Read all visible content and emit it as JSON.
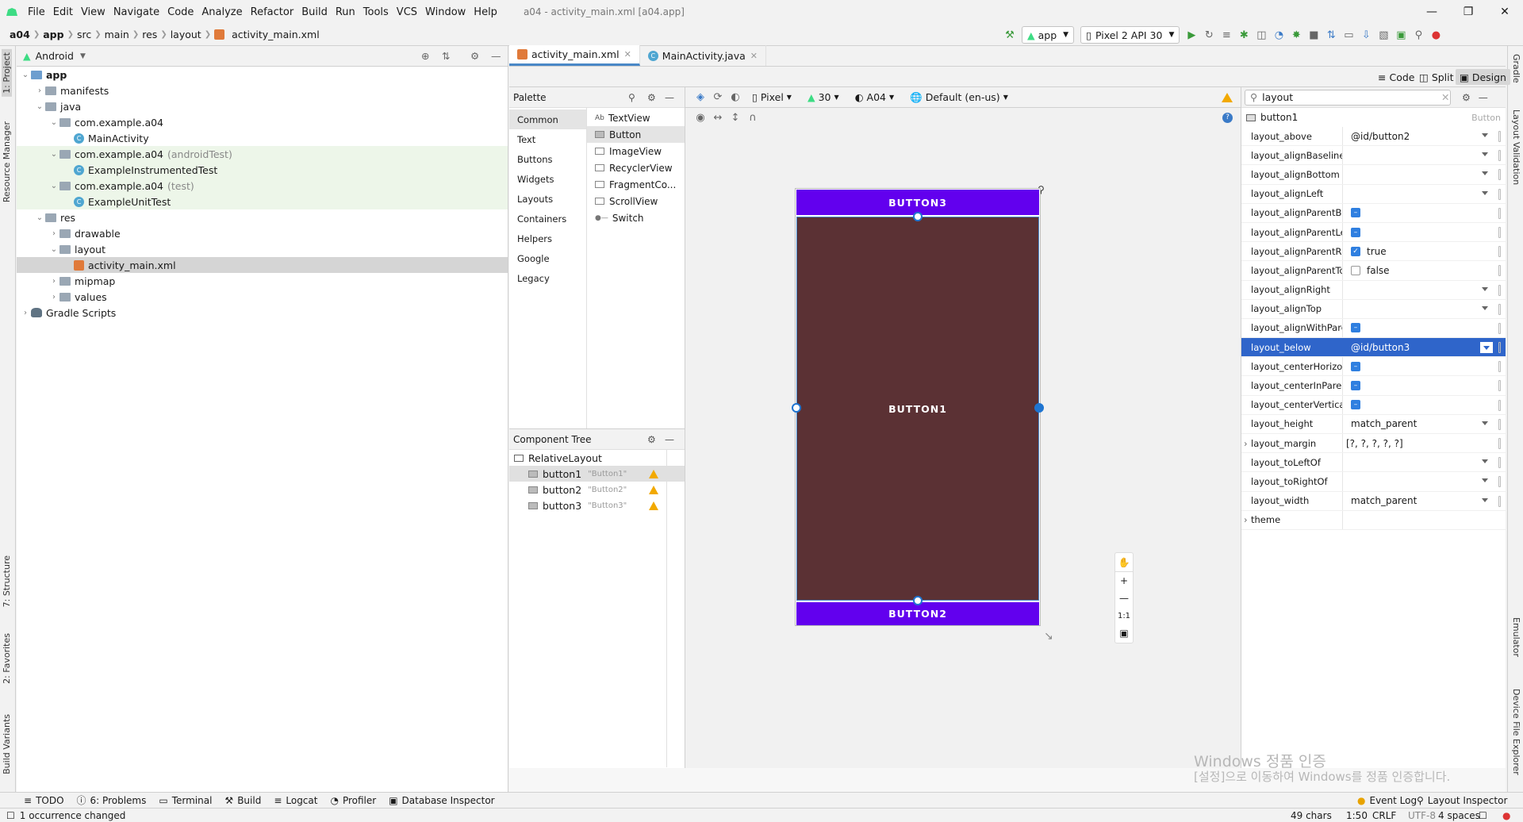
{
  "window": {
    "title": "a04 - activity_main.xml [a04.app]",
    "menu": [
      "File",
      "Edit",
      "View",
      "Navigate",
      "Code",
      "Analyze",
      "Refactor",
      "Build",
      "Run",
      "Tools",
      "VCS",
      "Window",
      "Help"
    ]
  },
  "breadcrumb": [
    "a04",
    "app",
    "src",
    "main",
    "res",
    "layout",
    "activity_main.xml"
  ],
  "toolbar": {
    "run_config": "app",
    "device": "Pixel 2 API 30"
  },
  "project": {
    "view": "Android",
    "tree": [
      {
        "label": "app",
        "indent": 0,
        "arrow": "v",
        "icon": "folder-src",
        "bold": true
      },
      {
        "label": "manifests",
        "indent": 1,
        "arrow": ">",
        "icon": "folder"
      },
      {
        "label": "java",
        "indent": 1,
        "arrow": "v",
        "icon": "folder"
      },
      {
        "label": "com.example.a04",
        "indent": 2,
        "arrow": "v",
        "icon": "folder"
      },
      {
        "label": "MainActivity",
        "indent": 3,
        "arrow": "",
        "icon": "class"
      },
      {
        "label": "com.example.a04",
        "sub": "(androidTest)",
        "indent": 2,
        "arrow": "v",
        "icon": "folder",
        "test": true
      },
      {
        "label": "ExampleInstrumentedTest",
        "indent": 3,
        "arrow": "",
        "icon": "class",
        "test": true
      },
      {
        "label": "com.example.a04",
        "sub": "(test)",
        "indent": 2,
        "arrow": "v",
        "icon": "folder",
        "test": true
      },
      {
        "label": "ExampleUnitTest",
        "indent": 3,
        "arrow": "",
        "icon": "class",
        "test": true
      },
      {
        "label": "res",
        "indent": 1,
        "arrow": "v",
        "icon": "folder"
      },
      {
        "label": "drawable",
        "indent": 2,
        "arrow": ">",
        "icon": "folder"
      },
      {
        "label": "layout",
        "indent": 2,
        "arrow": "v",
        "icon": "folder"
      },
      {
        "label": "activity_main.xml",
        "indent": 3,
        "arrow": "",
        "icon": "xml",
        "sel": true
      },
      {
        "label": "mipmap",
        "indent": 2,
        "arrow": ">",
        "icon": "folder"
      },
      {
        "label": "values",
        "indent": 2,
        "arrow": ">",
        "icon": "folder"
      },
      {
        "label": "Gradle Scripts",
        "indent": 0,
        "arrow": ">",
        "icon": "gradle"
      }
    ]
  },
  "left_tabs": {
    "project": "1: Project",
    "resource": "Resource Manager",
    "structure": "7: Structure",
    "favorites": "2: Favorites",
    "variants": "Build Variants"
  },
  "right_tabs": {
    "gradle": "Gradle",
    "validation": "Layout Validation",
    "emulator": "Emulator",
    "device_explorer": "Device File Explorer"
  },
  "editor": {
    "tabs": [
      "activity_main.xml",
      "MainActivity.java"
    ],
    "modes": {
      "code": "Code",
      "split": "Split",
      "design": "Design"
    }
  },
  "palette": {
    "title": "Palette",
    "categories": [
      "Common",
      "Text",
      "Buttons",
      "Widgets",
      "Layouts",
      "Containers",
      "Helpers",
      "Google",
      "Legacy"
    ],
    "widgets": [
      "TextView",
      "Button",
      "ImageView",
      "RecyclerView",
      "FragmentCo...",
      "ScrollView",
      "Switch"
    ]
  },
  "design_toolbar": {
    "device": "Pixel",
    "api": "30",
    "theme": "A04",
    "locale": "Default (en-us)"
  },
  "component_tree": {
    "title": "Component Tree",
    "root": "RelativeLayout",
    "items": [
      {
        "id": "button1",
        "text": "\"Button1\""
      },
      {
        "id": "button2",
        "text": "\"Button2\""
      },
      {
        "id": "button3",
        "text": "\"Button3\""
      }
    ]
  },
  "preview": {
    "button3": "BUTTON3",
    "button1": "BUTTON1",
    "button2": "BUTTON2"
  },
  "attributes": {
    "search": "layout",
    "component": "button1",
    "component_type": "Button",
    "rows": [
      {
        "name": "layout_above",
        "value": "@id/button2",
        "dd": true
      },
      {
        "name": "layout_alignBaseline",
        "value": "",
        "dd": true
      },
      {
        "name": "layout_alignBottom",
        "value": "",
        "dd": true
      },
      {
        "name": "layout_alignLeft",
        "value": "",
        "dd": true
      },
      {
        "name": "layout_alignParentBo...",
        "value": "",
        "check": "minus"
      },
      {
        "name": "layout_alignParentLeft",
        "value": "",
        "check": "minus"
      },
      {
        "name": "layout_alignParentRi...",
        "value": "true",
        "check": "checked"
      },
      {
        "name": "layout_alignParentTop",
        "value": "false",
        "check": "empty"
      },
      {
        "name": "layout_alignRight",
        "value": "",
        "dd": true
      },
      {
        "name": "layout_alignTop",
        "value": "",
        "dd": true
      },
      {
        "name": "layout_alignWithPare...",
        "value": "",
        "check": "minus"
      },
      {
        "name": "layout_below",
        "value": "@id/button3",
        "dd": true,
        "sel": true
      },
      {
        "name": "layout_centerHorizon...",
        "value": "",
        "check": "minus"
      },
      {
        "name": "layout_centerInParent",
        "value": "",
        "check": "minus"
      },
      {
        "name": "layout_centerVertical",
        "value": "",
        "check": "minus"
      },
      {
        "name": "layout_height",
        "value": "match_parent",
        "dd": true
      },
      {
        "name": "layout_margin",
        "value": "[?, ?, ?, ?, ?]",
        "expand": true
      },
      {
        "name": "layout_toLeftOf",
        "value": "",
        "dd": true
      },
      {
        "name": "layout_toRightOf",
        "value": "",
        "dd": true
      },
      {
        "name": "layout_width",
        "value": "match_parent",
        "dd": true
      },
      {
        "name": "theme",
        "value": "",
        "expand": true
      }
    ]
  },
  "bottom_tools": [
    "TODO",
    "6: Problems",
    "Terminal",
    "Build",
    "Logcat",
    "Profiler",
    "Database Inspector"
  ],
  "bottom_right_tools": [
    "Event Log",
    "Layout Inspector"
  ],
  "status": {
    "message": "1 occurrence changed",
    "chars": "49 chars",
    "position": "1:50",
    "line_sep": "CRLF",
    "encoding": "UTF-8",
    "indent": "4 spaces"
  },
  "watermark": {
    "line1": "Windows 정품 인증",
    "line2": "[설정]으로 이동하여 Windows를 정품 인증합니다."
  },
  "colors": {
    "accent": "#6200ee",
    "button1_bg": "#5b3134",
    "selection": "#2f65ca",
    "warning": "#f2a900"
  }
}
